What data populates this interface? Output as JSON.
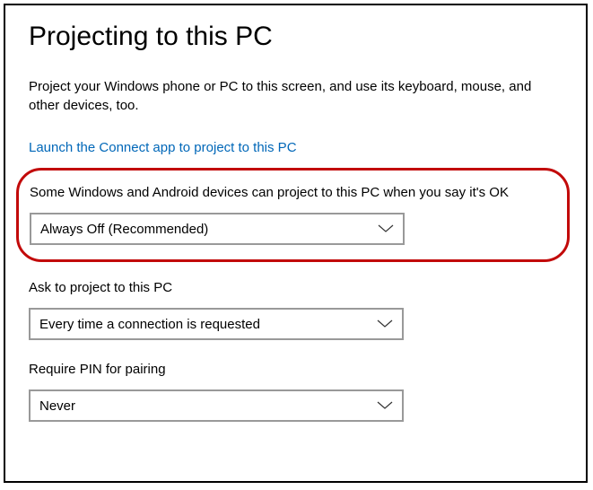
{
  "header": {
    "title": "Projecting to this PC"
  },
  "description": "Project your Windows phone or PC to this screen, and use its keyboard, mouse, and other devices, too.",
  "link": {
    "label": "Launch the Connect app to project to this PC"
  },
  "settings": {
    "projection": {
      "label": "Some Windows and Android devices can project to this PC when you say it's OK",
      "value": "Always Off (Recommended)"
    },
    "ask": {
      "label": "Ask to project to this PC",
      "value": "Every time a connection is requested"
    },
    "pin": {
      "label": "Require PIN for pairing",
      "value": "Never"
    }
  }
}
